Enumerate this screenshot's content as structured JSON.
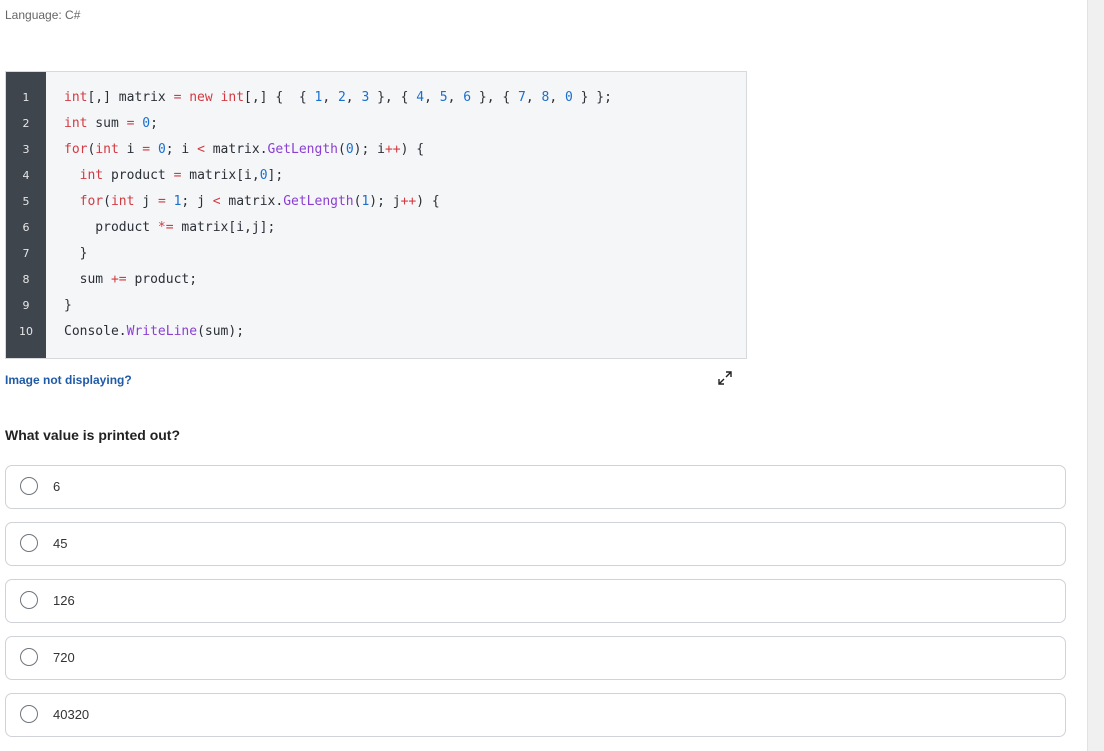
{
  "language_label": "Language: C#",
  "code": {
    "line_numbers": [
      "1",
      "2",
      "3",
      "4",
      "5",
      "6",
      "7",
      "8",
      "9",
      "10"
    ]
  },
  "image_link": "Image not displaying?",
  "expand_icon": "expand-icon",
  "question": "What value is printed out?",
  "options": [
    {
      "label": "6"
    },
    {
      "label": "45"
    },
    {
      "label": "126"
    },
    {
      "label": "720"
    },
    {
      "label": "40320"
    }
  ],
  "colors": {
    "gutter": "#3f454d",
    "code_bg": "#f5f6f7",
    "keyword": "#d23a43",
    "number": "#1a6fcf",
    "method": "#8a3fd1",
    "link": "#1f5aa6"
  }
}
